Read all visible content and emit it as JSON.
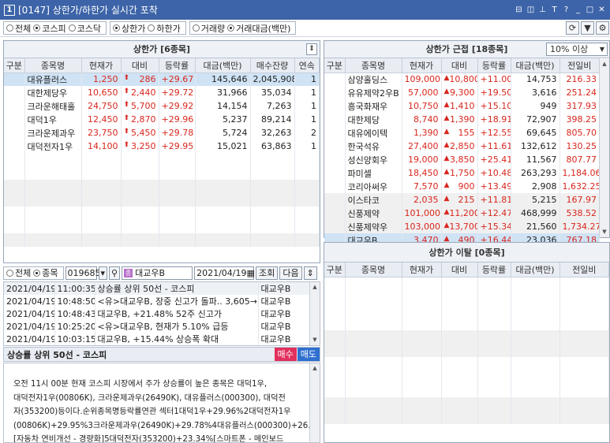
{
  "window": {
    "code": "[0147]",
    "title": "상한가/하한가 실시간 포착",
    "num_icon": "1"
  },
  "filters": {
    "market": [
      {
        "label": "전체",
        "on": false
      },
      {
        "label": "코스피",
        "on": true
      },
      {
        "label": "코스닥",
        "on": false
      }
    ],
    "limit": [
      {
        "label": "상한가",
        "on": true
      },
      {
        "label": "하한가",
        "on": false
      }
    ],
    "sort": [
      {
        "label": "거래량",
        "on": false
      },
      {
        "label": "거래대금(백만)",
        "on": true
      }
    ]
  },
  "left_panel": {
    "title": "상한가 [6종목]",
    "headers": [
      "구분",
      "종목명",
      "현재가",
      "대비",
      "등락률",
      "대금(백만)",
      "매수잔량",
      "연속"
    ],
    "rows": [
      {
        "name": "대유플러스",
        "price": "1,250",
        "diff": "286",
        "rate": "+29.67",
        "amount": "145,646",
        "bid": "2,045,908",
        "cont": "1",
        "sel": true
      },
      {
        "name": "대한제당우",
        "price": "10,650",
        "diff": "2,440",
        "rate": "+29.72",
        "amount": "31,966",
        "bid": "35,034",
        "cont": "1",
        "sel": false
      },
      {
        "name": "크라운해태홀",
        "price": "24,750",
        "diff": "5,700",
        "rate": "+29.92",
        "amount": "14,154",
        "bid": "7,263",
        "cont": "1",
        "sel": false
      },
      {
        "name": "대덕1우",
        "price": "12,450",
        "diff": "2,870",
        "rate": "+29.96",
        "amount": "5,237",
        "bid": "89,214",
        "cont": "1",
        "sel": false
      },
      {
        "name": "크라운제과우",
        "price": "23,750",
        "diff": "5,450",
        "rate": "+29.78",
        "amount": "5,724",
        "bid": "32,263",
        "cont": "2",
        "sel": false
      },
      {
        "name": "대덕전자1우",
        "price": "14,100",
        "diff": "3,250",
        "rate": "+29.95",
        "amount": "15,021",
        "bid": "63,863",
        "cont": "1",
        "sel": false
      }
    ]
  },
  "right_panel": {
    "title": "상한가 근접 [18종목]",
    "threshold": "10% 이상",
    "headers": [
      "구분",
      "종목명",
      "현재가",
      "대비",
      "등락률",
      "대금(백만)",
      "전일비"
    ],
    "rows": [
      {
        "name": "삼양홀딩스",
        "price": "109,000",
        "diff": "10,800",
        "rate": "+11.00",
        "amount": "14,753",
        "prev": "216.33"
      },
      {
        "name": "유유제약2우B",
        "price": "57,000",
        "diff": "9,300",
        "rate": "+19.50",
        "amount": "3,616",
        "prev": "251.24"
      },
      {
        "name": "흥국화재우",
        "price": "10,750",
        "diff": "1,410",
        "rate": "+15.10",
        "amount": "949",
        "prev": "317.93"
      },
      {
        "name": "대한제당",
        "price": "8,740",
        "diff": "1,390",
        "rate": "+18.91",
        "amount": "72,907",
        "prev": "398.25"
      },
      {
        "name": "대유에이텍",
        "price": "1,390",
        "diff": "155",
        "rate": "+12.55",
        "amount": "69,645",
        "prev": "805.70"
      },
      {
        "name": "한국석유",
        "price": "27,400",
        "diff": "2,850",
        "rate": "+11.61",
        "amount": "132,612",
        "prev": "130.25"
      },
      {
        "name": "성신양회우",
        "price": "19,000",
        "diff": "3,850",
        "rate": "+25.41",
        "amount": "11,567",
        "prev": "807.77"
      },
      {
        "name": "파미셀",
        "price": "18,450",
        "diff": "1,750",
        "rate": "+10.48",
        "amount": "263,293",
        "prev": "1,184.06"
      },
      {
        "name": "코리아써우",
        "price": "7,570",
        "diff": "900",
        "rate": "+13.49",
        "amount": "2,908",
        "prev": "1,632.25"
      },
      {
        "name": "이스타코",
        "price": "2,035",
        "diff": "215",
        "rate": "+11.81",
        "amount": "5,215",
        "prev": "167.97"
      },
      {
        "name": "신풍제약",
        "price": "101,000",
        "diff": "11,200",
        "rate": "+12.47",
        "amount": "468,999",
        "prev": "538.52"
      },
      {
        "name": "신풍제약우",
        "price": "103,000",
        "diff": "13,700",
        "rate": "+15.34",
        "amount": "21,560",
        "prev": "1,734.27"
      },
      {
        "name": "대교우B",
        "price": "3,470",
        "diff": "490",
        "rate": "+16.44",
        "amount": "23,036",
        "prev": "767.18"
      }
    ]
  },
  "right_bottom": {
    "title": "상한가 이탈 [0종목]",
    "headers": [
      "구분",
      "종목명",
      "현재가",
      "대비",
      "등락률",
      "대금(백만)",
      "전일비"
    ]
  },
  "news": {
    "radio": [
      {
        "label": "전체",
        "on": false
      },
      {
        "label": "종목",
        "on": true
      }
    ],
    "code": "019685",
    "stock_name": "대교우B",
    "date": "2021/04/19",
    "lookup": "조회",
    "next": "다음",
    "items": [
      {
        "date": "2021/04/19",
        "time": "11:00:35",
        "text": "상승률 상위 50선 - 코스피",
        "stock": "대교우B"
      },
      {
        "date": "2021/04/19",
        "time": "10:48:50",
        "text": "<유>대교우B, 장중 신고가 돌파.. 3,605→3,",
        "stock": "대교우B"
      },
      {
        "date": "2021/04/19",
        "time": "10:48:43",
        "text": "대교우B, +21.48% 52주 신고가",
        "stock": "대교우B"
      },
      {
        "date": "2021/04/19",
        "time": "10:25:20",
        "text": "<유>대교우B, 현재가 5.10% 급등",
        "stock": "대교우B"
      },
      {
        "date": "2021/04/19",
        "time": "10:03:15",
        "text": "대교우B, +15.44% 상승폭 확대",
        "stock": "대교우B"
      }
    ],
    "detail_title": "상승률 상위 50선 - 코스피",
    "buy": "매수",
    "sell": "매도",
    "body_lines": [
      "오전 11시 00분 현재 코스피 시장에서 주가 상승률이 높은 종목은 대덕1우,",
      "대덕전자1우(00806K), 크라운제과우(26490K), 대유플러스(000300), 대덕전",
      "자(353200)등이다.순위종목명등락률연관 섹터1대덕1우+29.96%2대덕전자1우",
      "(00806K)+29.95%3크라운제과우(26490K)+29.78%4대유플러스(000300)+26.04%",
      "[자동차 연비개선 - 경량화]5대덕전자(353200)+23.34%[스마트폰 - 메인보드"
    ]
  }
}
